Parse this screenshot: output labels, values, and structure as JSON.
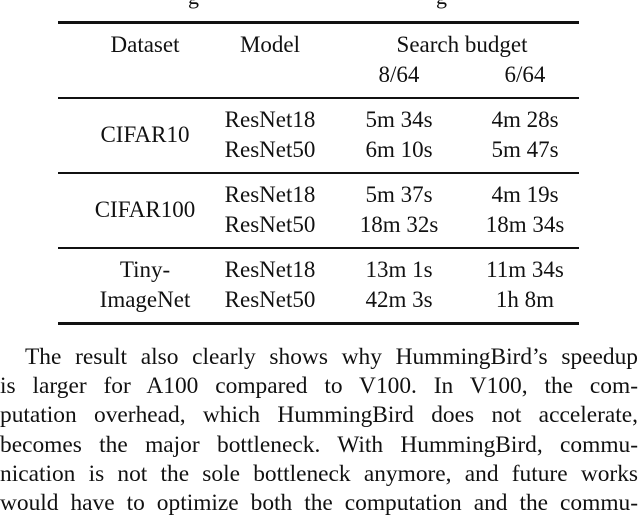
{
  "caption_fragment": "g                                         g",
  "table": {
    "headers": {
      "dataset": "Dataset",
      "model": "Model",
      "search_budget": "Search budget",
      "budget_8": "8/64",
      "budget_6": "6/64"
    },
    "groups": [
      {
        "dataset_lines": [
          "CIFAR10"
        ],
        "rows": [
          {
            "model": "ResNet18",
            "b8": "5m 34s",
            "b6": "4m 28s"
          },
          {
            "model": "ResNet50",
            "b8": "6m 10s",
            "b6": "5m 47s"
          }
        ]
      },
      {
        "dataset_lines": [
          "CIFAR100"
        ],
        "rows": [
          {
            "model": "ResNet18",
            "b8": "5m 37s",
            "b6": "4m 19s"
          },
          {
            "model": "ResNet50",
            "b8": "18m 32s",
            "b6": "18m 34s"
          }
        ]
      },
      {
        "dataset_lines": [
          "Tiny-",
          "ImageNet"
        ],
        "rows": [
          {
            "model": "ResNet18",
            "b8": "13m 1s",
            "b6": "11m 34s"
          },
          {
            "model": "ResNet50",
            "b8": "42m 3s",
            "b6": "1h 8m"
          }
        ]
      }
    ]
  },
  "paragraph": {
    "lines": [
      "The result also clearly shows why HummingBird’s speedup",
      "is larger for A100 compared to V100.  In V100, the com-",
      "putation overhead, which HummingBird does not accelerate,",
      "becomes the major bottleneck. With HummingBird, commu-",
      "nication is not the sole bottleneck anymore, and future works",
      "would have to optimize both the computation and the commu-"
    ]
  }
}
